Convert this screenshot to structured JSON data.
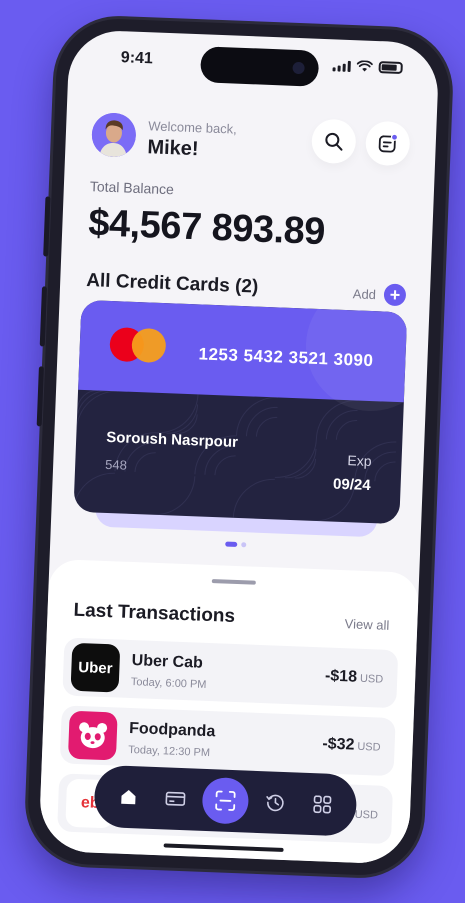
{
  "status_bar": {
    "time": "9:41"
  },
  "header": {
    "welcome": "Welcome back,",
    "user_name": "Mike!",
    "search_icon": "search-icon",
    "notification_icon": "notification-icon"
  },
  "balance": {
    "label": "Total Balance",
    "amount": "$4,567 893.89"
  },
  "cards": {
    "title": "All Credit Cards (2)",
    "add_label": "Add",
    "add_symbol": "+",
    "card": {
      "brand_icon": "mastercard-logo",
      "number": "1253 5432 3521 3090",
      "holder": "Soroush Nasrpour",
      "cvv": "548",
      "exp_label": "Exp",
      "exp_value": "09/24"
    },
    "page_indicator": {
      "pages": 2,
      "active": 1
    }
  },
  "transactions": {
    "title": "Last Transactions",
    "view_all": "View all",
    "items": [
      {
        "name": "Uber Cab",
        "time": "Today, 6:00 PM",
        "amount": "-$18",
        "currency": "USD",
        "logo_text": "Uber",
        "logo_bg": "#0d0d0d",
        "logo_fg": "#ffffff"
      },
      {
        "name": "Foodpanda",
        "time": "Today, 12:30 PM",
        "amount": "-$32",
        "currency": "USD",
        "logo_text": "",
        "logo_bg": "#e21b70",
        "logo_fg": "#ffffff"
      },
      {
        "name": "",
        "time": "",
        "amount": "",
        "currency": "USD",
        "logo_text": "eb",
        "logo_bg": "#ffffff",
        "logo_fg": "#e53238"
      }
    ]
  },
  "tab_bar": {
    "items": [
      {
        "icon": "home-icon",
        "active": false
      },
      {
        "icon": "card-icon",
        "active": false
      },
      {
        "icon": "scan-icon",
        "active": true
      },
      {
        "icon": "history-icon",
        "active": false
      },
      {
        "icon": "grid-icon",
        "active": false
      }
    ]
  },
  "colors": {
    "background": "#6a5cf0",
    "accent": "#6a5cf0",
    "card_dark": "#232340",
    "tab_bar": "#1f1f3a"
  }
}
